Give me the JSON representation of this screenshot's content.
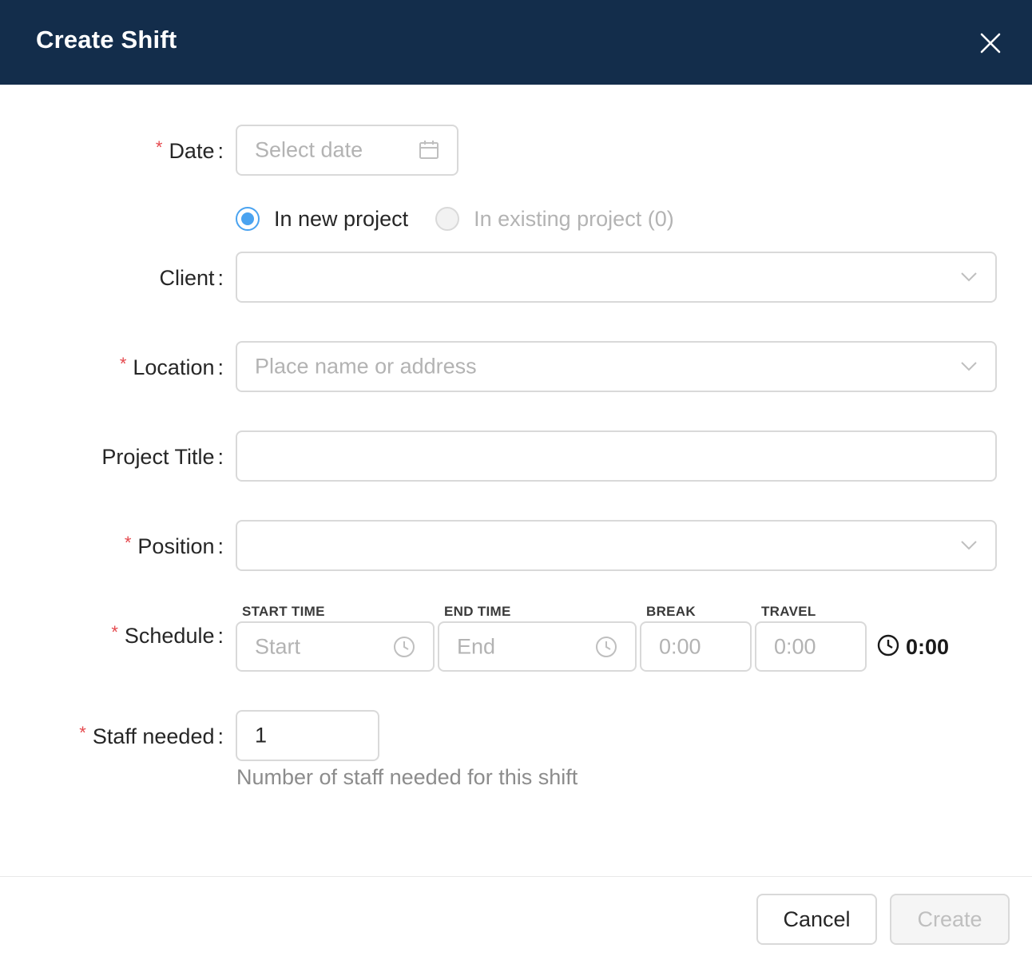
{
  "dialog": {
    "title": "Create Shift",
    "close_icon": "close-icon"
  },
  "form": {
    "date": {
      "label": "Date",
      "required": true,
      "placeholder": "Select date",
      "icon": "calendar-icon"
    },
    "project_mode": {
      "options": [
        {
          "label": "In new project",
          "selected": true,
          "disabled": false
        },
        {
          "label": "In existing project (0)",
          "selected": false,
          "disabled": true
        }
      ]
    },
    "client": {
      "label": "Client",
      "required": false,
      "value": "",
      "icon": "chevron-down-icon"
    },
    "location": {
      "label": "Location",
      "required": true,
      "placeholder": "Place name or address",
      "icon": "chevron-down-icon"
    },
    "project_title": {
      "label": "Project Title",
      "required": false,
      "value": ""
    },
    "position": {
      "label": "Position",
      "required": true,
      "value": "",
      "icon": "chevron-down-icon"
    },
    "schedule": {
      "label": "Schedule",
      "required": true,
      "start": {
        "header": "START TIME",
        "placeholder": "Start",
        "icon": "clock-icon"
      },
      "end": {
        "header": "END TIME",
        "placeholder": "End",
        "icon": "clock-icon"
      },
      "break": {
        "header": "BREAK",
        "placeholder": "0:00"
      },
      "travel": {
        "header": "TRAVEL",
        "placeholder": "0:00"
      },
      "total": "0:00"
    },
    "staff_needed": {
      "label": "Staff needed",
      "required": true,
      "value": "1",
      "hint": "Number of staff needed for this shift"
    }
  },
  "footer": {
    "cancel_label": "Cancel",
    "create_label": "Create"
  },
  "colors": {
    "header_bg": "#132d4b",
    "accent": "#4aa3f0",
    "required": "#e5484d"
  }
}
